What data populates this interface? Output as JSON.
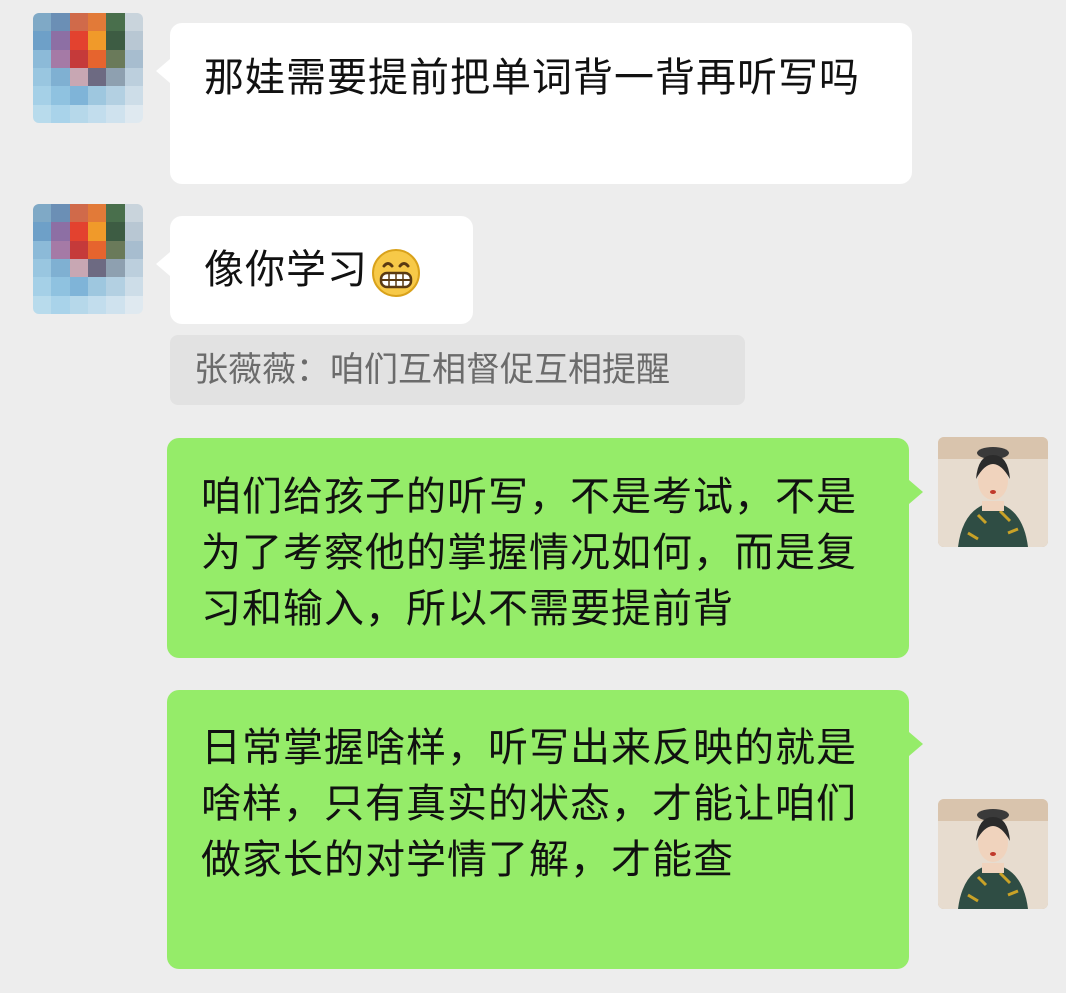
{
  "messages": [
    {
      "side": "in",
      "text": "那娃需要提前把单词背一背再听写吗"
    },
    {
      "side": "in",
      "text": "像你学习",
      "emoji": "grinning-face-icon"
    },
    {
      "side": "quote",
      "text": "张薇薇：咱们互相督促互相提醒"
    },
    {
      "side": "out",
      "text": "咱们给孩子的听写，不是考试，不是为了考察他的掌握情况如何，而是复习和输入，所以不需要提前背"
    },
    {
      "side": "out",
      "text": "日常掌握啥样，听写出来反映的就是啥样，只有真实的状态，才能让咱们做家长的对学情了解，才能查"
    }
  ],
  "colors": {
    "background": "#ededed",
    "incoming_bubble": "#ffffff",
    "outgoing_bubble": "#95ec69",
    "quote_bg": "#e2e2e2",
    "quote_text": "#6b6b6b"
  }
}
